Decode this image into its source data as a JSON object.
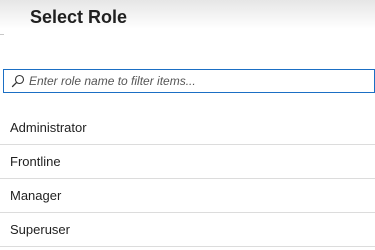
{
  "dialog": {
    "title": "Select Role"
  },
  "search": {
    "placeholder": "Enter role name to filter items...",
    "value": ""
  },
  "roles": [
    {
      "label": "Administrator"
    },
    {
      "label": "Frontline"
    },
    {
      "label": "Manager"
    },
    {
      "label": "Superuser"
    }
  ],
  "colors": {
    "accent": "#1b6fc4",
    "divider": "#dcdcdc"
  },
  "icons": {
    "search": "search-icon"
  }
}
